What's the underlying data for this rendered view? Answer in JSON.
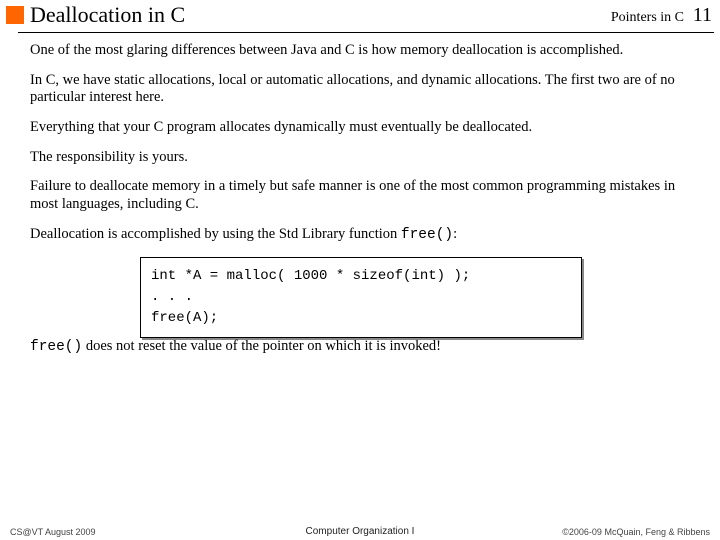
{
  "header": {
    "title": "Deallocation in C",
    "chapter": "Pointers in C",
    "page": "11"
  },
  "body": {
    "p1": "One of the most glaring differences between Java and C is how memory deallocation is accomplished.",
    "p2": "In C, we have static allocations, local or automatic allocations, and dynamic allocations. The first two are of no particular interest here.",
    "p3": "Everything that your C program allocates dynamically must eventually be deallocated.",
    "p4": "The responsibility is yours.",
    "p5": "Failure to deallocate memory in a timely but safe manner is one of the most common programming mistakes in most languages, including C.",
    "p6a": "Deallocation is accomplished by using the Std Library function ",
    "p6b": "free()",
    "p6c": ":",
    "code1": "int  *A = malloc( 1000 * sizeof(int) );",
    "code2": ". . .",
    "code3": "free(A);",
    "noteA": "free()",
    "noteB": " does not reset the value of the pointer on which it is invoked!"
  },
  "footer": {
    "left": "CS@VT August 2009",
    "center": "Computer Organization I",
    "right": "©2006-09 McQuain, Feng & Ribbens"
  }
}
